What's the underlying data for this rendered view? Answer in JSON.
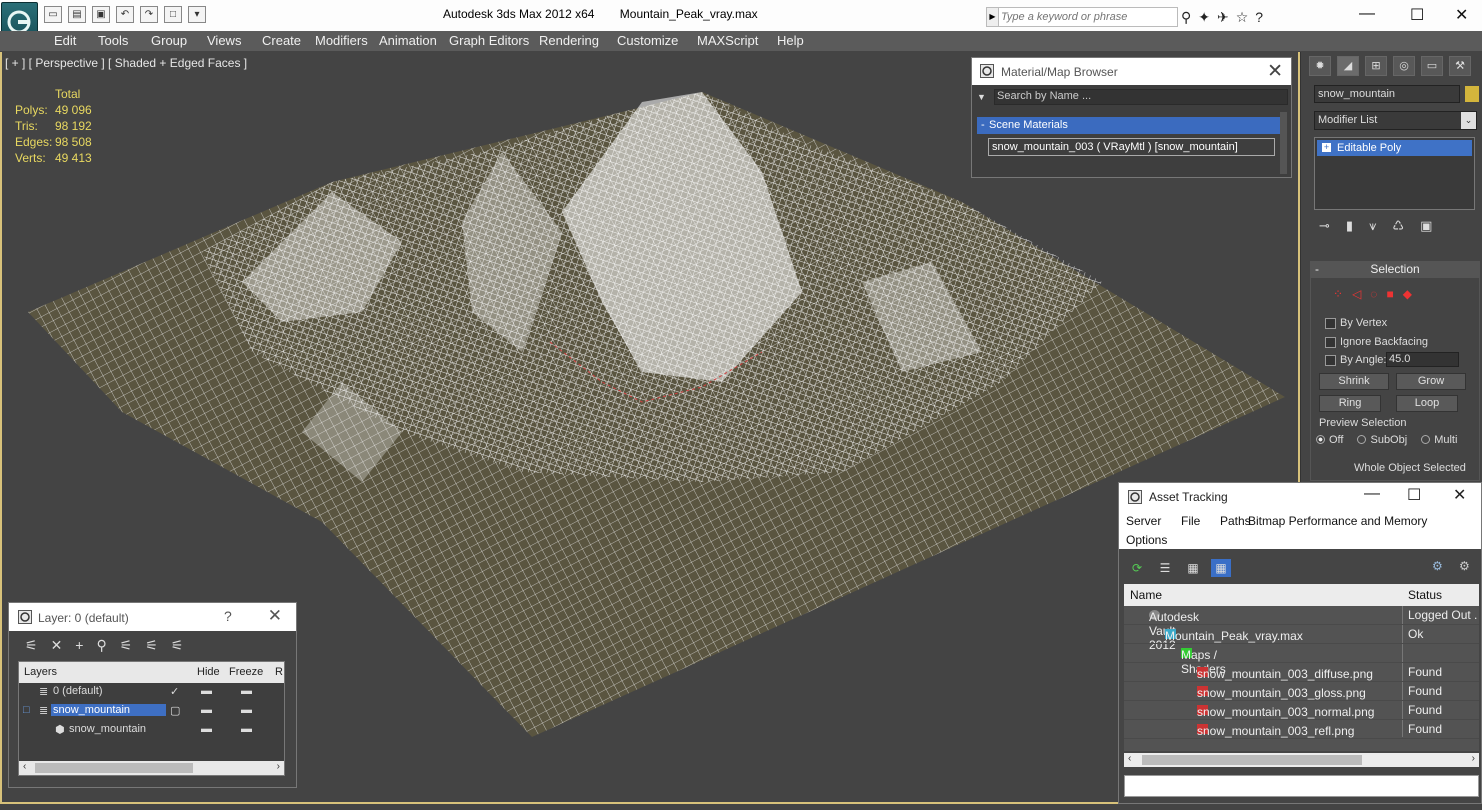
{
  "titlebar": {
    "app": "Autodesk 3ds Max  2012 x64",
    "file": "Mountain_Peak_vray.max",
    "search_placeholder": "Type a keyword or phrase",
    "help": "?"
  },
  "menu": [
    "Edit",
    "Tools",
    "Group",
    "Views",
    "Create",
    "Modifiers",
    "Animation",
    "Graph Editors",
    "Rendering",
    "Customize",
    "MAXScript",
    "Help"
  ],
  "viewport": {
    "label": "[ + ] [ Perspective ] [ Shaded + Edged Faces ]",
    "stats_header": "Total",
    "stats": [
      {
        "label": "Polys:",
        "value": "49 096"
      },
      {
        "label": "Tris:",
        "value": "98 192"
      },
      {
        "label": "Edges:",
        "value": "98 508"
      },
      {
        "label": "Verts:",
        "value": "49 413"
      }
    ]
  },
  "material_browser": {
    "title": "Material/Map Browser",
    "search_placeholder": "Search by Name ...",
    "section": "Scene Materials",
    "section_toggle": "-",
    "item": "snow_mountain_003  ( VRayMtl )  [snow_mountain]"
  },
  "command_panel": {
    "object_name": "snow_mountain",
    "modifier_list": "Modifier List",
    "stack_item": "Editable Poly",
    "rollout_title": "Selection",
    "by_vertex": "By Vertex",
    "ignore_backfacing": "Ignore Backfacing",
    "by_angle": "By Angle:",
    "angle_value": "45.0",
    "shrink": "Shrink",
    "grow": "Grow",
    "ring": "Ring",
    "loop": "Loop",
    "preview_selection": "Preview Selection",
    "preview_off": "Off",
    "preview_subobj": "SubObj",
    "preview_multi": "Multi",
    "whole_object": "Whole Object Selected"
  },
  "layer_dialog": {
    "title": "Layer: 0 (default)",
    "help": "?",
    "columns": {
      "layers": "Layers",
      "hide": "Hide",
      "freeze": "Freeze",
      "render": "R"
    },
    "rows": [
      {
        "name": "0 (default)"
      },
      {
        "name": "snow_mountain"
      },
      {
        "name": "snow_mountain"
      }
    ]
  },
  "asset_tracking": {
    "title": "Asset Tracking",
    "menu": [
      "Server",
      "File",
      "Paths",
      "Bitmap Performance and Memory",
      "Options"
    ],
    "columns": {
      "name": "Name",
      "status": "Status"
    },
    "rows": [
      {
        "name": "Autodesk Vault 2012",
        "status": "Logged Out ."
      },
      {
        "name": "Mountain_Peak_vray.max",
        "status": "Ok"
      },
      {
        "name": "Maps / Shaders",
        "status": ""
      },
      {
        "name": "snow_mountain_003_diffuse.png",
        "status": "Found"
      },
      {
        "name": "snow_mountain_003_gloss.png",
        "status": "Found"
      },
      {
        "name": "snow_mountain_003_normal.png",
        "status": "Found"
      },
      {
        "name": "snow_mountain_003_refl.png",
        "status": "Found"
      }
    ]
  },
  "colors": {
    "viewport_bg": "#444444",
    "wire": "#ffffff",
    "mesh_base": "#5a5540",
    "selection_blue": "#3e6fc3",
    "stats_yellow": "#e8d860"
  }
}
